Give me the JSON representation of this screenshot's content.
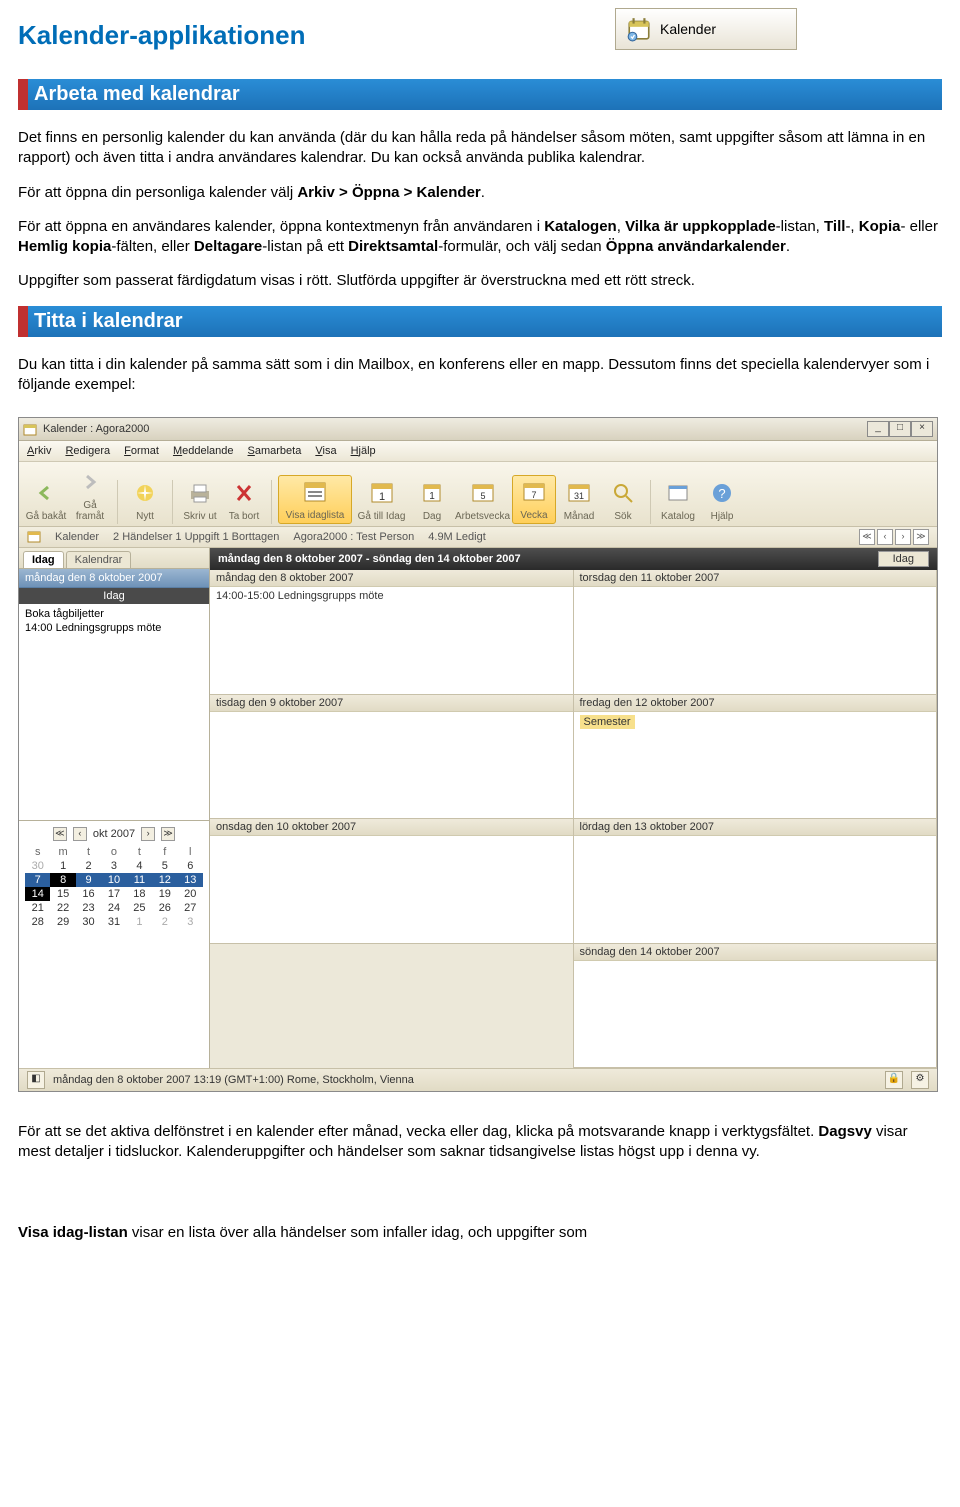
{
  "page_title": "Kalender-applikationen",
  "badge_label": "Kalender",
  "sections": {
    "s1_title": "Arbeta med kalendrar",
    "s2_title": "Titta i kalendrar"
  },
  "para1a": "Det finns en personlig kalender du kan använda (där du kan hålla reda på händelser såsom möten, samt uppgifter såsom att lämna in en rapport) och även titta i andra användares kalendrar. Du kan också använda publika kalendrar.",
  "para1b_pre": "För att öppna din personliga kalender välj ",
  "para1b_bold": "Arkiv > Öppna > Kalender",
  "para1b_post": ".",
  "para1c": "För att öppna en användares kalender, öppna kontextmenyn från användaren i Katalogen, Vilka är uppkopplade-listan, Till-, Kopia- eller Hemlig kopia-fälten, eller Deltagare-listan på ett Direktsamtal-formulär, och välj sedan Öppna användarkalender.",
  "para1d": "Uppgifter som passerat färdigdatum visas i rött. Slutförda uppgifter är överstruckna med ett rött streck.",
  "para2": "Du kan titta i din kalender på samma sätt som i din Mailbox, en konferens eller en mapp. Dessutom finns det speciella kalendervyer som i följande exempel:",
  "para3_pre": "För att se det aktiva delfönstret i en kalender efter månad, vecka eller dag, klicka på motsvarande knapp i verktygsfältet. ",
  "para3_bold": "Dagsvy",
  "para3_post": " visar mest detaljer i tidsluckor. Kalenderuppgifter och händelser som saknar tidsangivelse listas högst upp i denna vy.",
  "para4_pre": "",
  "para4_bold": "Visa idag-listan",
  "para4_post": " visar en lista över alla händelser som infaller idag, och uppgifter som",
  "app": {
    "title": "Kalender : Agora2000",
    "menu": [
      "Arkiv",
      "Redigera",
      "Format",
      "Meddelande",
      "Samarbeta",
      "Visa",
      "Hjälp"
    ],
    "toolbar": {
      "back": "Gå bakåt",
      "fwd": "Gå framåt",
      "new": "Nytt",
      "print": "Skriv ut",
      "delete": "Ta bort",
      "todaylist": "Visa idaglista",
      "gotoday": "Gå till Idag",
      "day": "Dag",
      "workweek": "Arbetsvecka",
      "week": "Vecka",
      "month": "Månad",
      "search": "Sök",
      "catalog": "Katalog",
      "help": "Hjälp"
    },
    "statusrow": {
      "cal": "Kalender",
      "events": "2 Händelser 1 Uppgift 1 Borttagen",
      "user": "Agora2000 : Test Person",
      "free": "4.9M Ledigt"
    },
    "tabs": {
      "idag": "Idag",
      "kalendrar": "Kalendrar"
    },
    "left_day_header": "måndag den 8 oktober 2007",
    "left_today_label": "Idag",
    "tasks": [
      "Boka tågbiljetter",
      "14:00 Ledningsgrupps möte"
    ],
    "minical": {
      "month": "okt 2007",
      "dow": [
        "s",
        "m",
        "t",
        "o",
        "t",
        "f",
        "l"
      ],
      "weeks": [
        [
          "30",
          "1",
          "2",
          "3",
          "4",
          "5",
          "6"
        ],
        [
          "7",
          "8",
          "9",
          "10",
          "11",
          "12",
          "13"
        ],
        [
          "14",
          "15",
          "16",
          "17",
          "18",
          "19",
          "20"
        ],
        [
          "21",
          "22",
          "23",
          "24",
          "25",
          "26",
          "27"
        ],
        [
          "28",
          "29",
          "30",
          "31",
          "1",
          "2",
          "3"
        ]
      ]
    },
    "week_header": "måndag den 8 oktober 2007 - söndag den 14 oktober 2007",
    "idag_btn": "Idag",
    "days": {
      "mon": "måndag den 8 oktober 2007",
      "tue": "tisdag den 9 oktober 2007",
      "wed": "onsdag den 10 oktober 2007",
      "thu": "torsdag den 11 oktober 2007",
      "fri": "fredag den 12 oktober 2007",
      "sat": "lördag den 13 oktober 2007",
      "sun": "söndag den 14 oktober 2007"
    },
    "mon_event": "14:00-15:00 Ledningsgrupps möte",
    "fri_event": "Semester",
    "statusbar": "måndag den 8 oktober 2007 13:19 (GMT+1:00) Rome, Stockholm, Vienna"
  }
}
